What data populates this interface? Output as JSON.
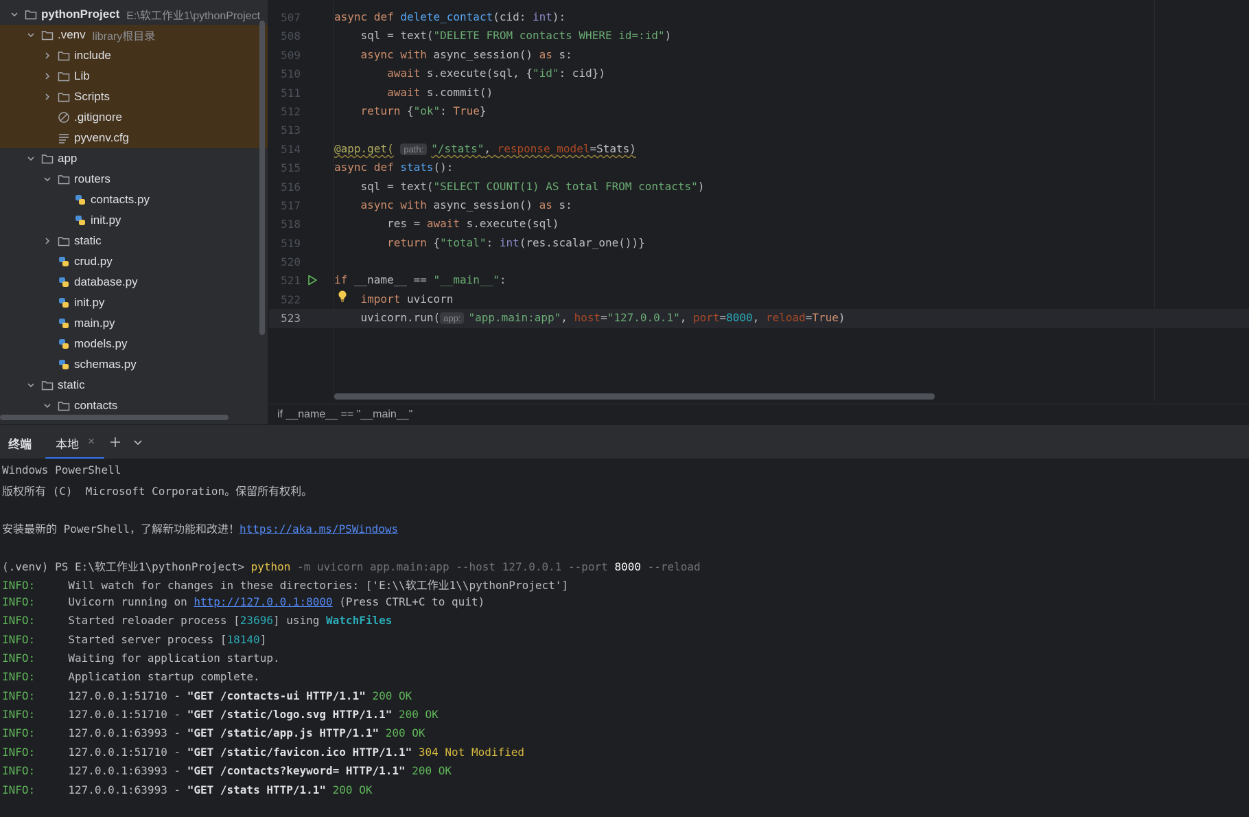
{
  "project_tree": {
    "root": {
      "label": "pythonProject",
      "path": "E:\\软工作业1\\pythonProject"
    },
    "venv": {
      "label": ".venv",
      "note": "library根目录"
    },
    "items": [
      {
        "label": "include"
      },
      {
        "label": "Lib"
      },
      {
        "label": "Scripts"
      },
      {
        "label": ".gitignore"
      },
      {
        "label": "pyvenv.cfg"
      },
      {
        "label": "app"
      },
      {
        "label": "routers"
      },
      {
        "label": "contacts.py"
      },
      {
        "label": "init.py"
      },
      {
        "label": "static"
      },
      {
        "label": "crud.py"
      },
      {
        "label": "database.py"
      },
      {
        "label": "init.py"
      },
      {
        "label": "main.py"
      },
      {
        "label": "models.py"
      },
      {
        "label": "schemas.py"
      },
      {
        "label": "static"
      },
      {
        "label": "contacts"
      }
    ]
  },
  "editor": {
    "line_numbers": [
      "507",
      "508",
      "509",
      "510",
      "511",
      "512",
      "513",
      "514",
      "515",
      "516",
      "517",
      "518",
      "519",
      "520",
      "521",
      "522",
      "523"
    ],
    "hints": {
      "path": "path:",
      "app": "app:"
    },
    "tokens": {
      "l507": [
        "async",
        " def ",
        "delete_contact",
        "(cid: ",
        "int",
        "):"
      ],
      "l508": [
        "    sql = text(",
        "\"DELETE FROM contacts WHERE id=:id\"",
        ")"
      ],
      "l509": [
        "    ",
        "async with",
        " async_session() ",
        "as",
        " s:"
      ],
      "l510": [
        "        ",
        "await",
        " s.execute(sql, {",
        "\"id\"",
        ": cid})"
      ],
      "l511": [
        "        ",
        "await",
        " s.commit()"
      ],
      "l512": [
        "    ",
        "return",
        " {",
        "\"ok\"",
        ": ",
        "True",
        "}"
      ],
      "l514": [
        "@app.get(",
        "\"/stats\"",
        ", ",
        "response_model",
        "=Stats)"
      ],
      "l515": [
        "async",
        " def ",
        "stats",
        "():"
      ],
      "l516": [
        "    sql = text(",
        "\"SELECT COUNT(1) AS total FROM contacts\"",
        ")"
      ],
      "l517": [
        "    ",
        "async with",
        " async_session() ",
        "as",
        " s:"
      ],
      "l518": [
        "        res = ",
        "await",
        " s.execute(sql)"
      ],
      "l519": [
        "        ",
        "return",
        " {",
        "\"total\"",
        ": ",
        "int",
        "(res.scalar_one())}"
      ],
      "l521": [
        "if",
        " __name__ == ",
        "\"__main__\"",
        ":"
      ],
      "l522": [
        "    ",
        "import",
        " uvicorn"
      ],
      "l523": [
        "    uvicorn.run(",
        "\"app.main:app\"",
        ", ",
        "host",
        "=",
        "\"127.0.0.1\"",
        ", ",
        "port",
        "=",
        "8000",
        ", ",
        "reload",
        "=",
        "True",
        ")"
      ]
    }
  },
  "breadcrumb": {
    "text": "if __name__ == \"__main__\""
  },
  "terminal_tabs": {
    "title": "终端",
    "local": "本地",
    "close": "×"
  },
  "terminal": {
    "header1": "Windows PowerShell",
    "header2": "版权所有 (C)  Microsoft Corporation。保留所有权利。",
    "install_text": "安装最新的 PowerShell，了解新功能和改进！",
    "install_link": "https://aka.ms/PSWindows",
    "prompt": "(.venv) PS E:\\软工作业1\\pythonProject> ",
    "cmd": "python",
    "cmd_args1": " -m uvicorn app.main:app --host 127.0.0.1 --port ",
    "cmd_port": "8000",
    "cmd_args2": " --reload",
    "info": "INFO:",
    "watch": "     Will watch for changes in these directories: ['E:\\\\软工作业1\\\\pythonProject']",
    "running_pre": "     Uvicorn running on ",
    "running_link": "http://127.0.0.1:8000",
    "running_post": " (Press CTRL+C to quit)",
    "reloader_pre": "     Started reloader process [",
    "reloader_pid": "23696",
    "reloader_mid": "] using ",
    "reloader_wf": "WatchFiles",
    "server_pre": "     Started server process [",
    "server_pid": "18140",
    "server_post": "]",
    "waiting": "     Waiting for application startup.",
    "complete": "     Application startup complete.",
    "requests": [
      {
        "addr": "     127.0.0.1:51710 - ",
        "req": "\"GET /contacts-ui HTTP/1.1\"",
        "status": " 200 OK",
        "kind": "ok"
      },
      {
        "addr": "     127.0.0.1:51710 - ",
        "req": "\"GET /static/logo.svg HTTP/1.1\"",
        "status": " 200 OK",
        "kind": "ok"
      },
      {
        "addr": "     127.0.0.1:63993 - ",
        "req": "\"GET /static/app.js HTTP/1.1\"",
        "status": " 200 OK",
        "kind": "ok"
      },
      {
        "addr": "     127.0.0.1:51710 - ",
        "req": "\"GET /static/favicon.ico HTTP/1.1\"",
        "status": " 304 Not Modified",
        "kind": "nm"
      },
      {
        "addr": "     127.0.0.1:63993 - ",
        "req": "\"GET /contacts?keyword= HTTP/1.1\"",
        "status": " 200 OK",
        "kind": "ok"
      },
      {
        "addr": "     127.0.0.1:63993 - ",
        "req": "\"GET /stats HTTP/1.1\"",
        "status": " 200 OK",
        "kind": "ok"
      }
    ]
  },
  "colors": {
    "accent": "#3574f0",
    "excluded_bg": "#45321b"
  },
  "icons": [
    "folder-icon",
    "python-file-icon",
    "gitignore-icon",
    "config-file-icon",
    "chevron-right-icon",
    "chevron-down-icon",
    "run-icon",
    "bulb-icon",
    "plus-icon"
  ]
}
